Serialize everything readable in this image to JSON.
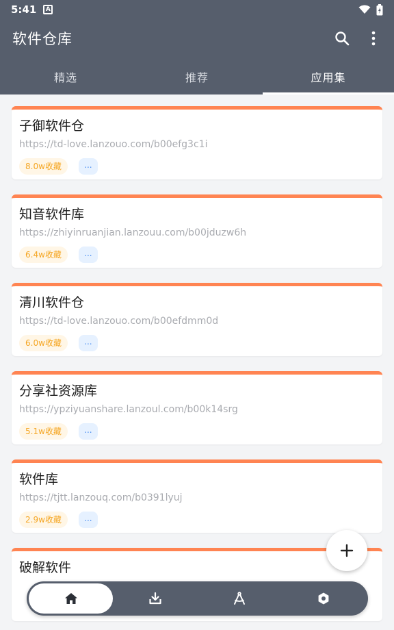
{
  "status": {
    "time": "5:41",
    "app_icon": "A"
  },
  "header": {
    "title": "软件仓库"
  },
  "tabs": [
    {
      "label": "精选"
    },
    {
      "label": "推荐"
    },
    {
      "label": "应用集",
      "active": true
    }
  ],
  "cards": [
    {
      "title": "子御软件仓",
      "url": "https://td-love.lanzouo.com/b00efg3c1i",
      "favorites": "8.0w收藏",
      "more": "..."
    },
    {
      "title": "知音软件库",
      "url": "https://zhiyinruanjian.lanzouu.com/b00jduzw6h",
      "favorites": "6.4w收藏",
      "more": "..."
    },
    {
      "title": "清川软件仓",
      "url": "https://td-love.lanzouo.com/b00efdmm0d",
      "favorites": "6.0w收藏",
      "more": "..."
    },
    {
      "title": "分享社资源库",
      "url": "https://ypziyuanshare.lanzoul.com/b00k14srg",
      "favorites": "5.1w收藏",
      "more": "..."
    },
    {
      "title": "软件库",
      "url": "https://tjtt.lanzouq.com/b0391lyuj",
      "favorites": "2.9w收藏",
      "more": "..."
    },
    {
      "title": "破解软件",
      "url": "",
      "favorites": "",
      "more": ""
    }
  ],
  "colors": {
    "appbar": "#565e6c",
    "accent": "#ff8452",
    "fav_text": "#f5a623",
    "more_text": "#4a8ef0"
  },
  "icons": {
    "search": "search-icon",
    "menu": "more-vert-icon",
    "fab": "plus-icon",
    "nav": [
      "home-icon",
      "download-icon",
      "compass-icon",
      "gear-icon"
    ]
  }
}
